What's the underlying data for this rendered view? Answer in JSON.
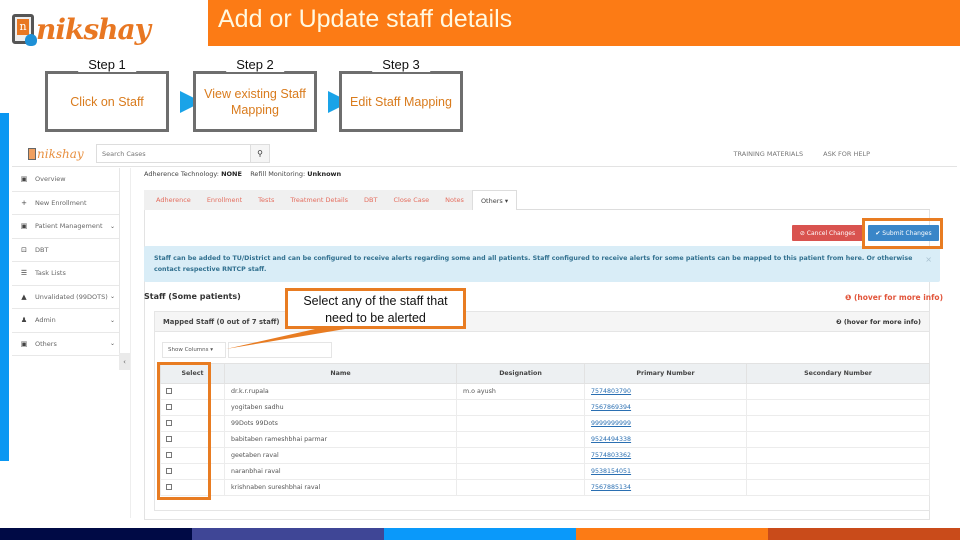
{
  "slide": {
    "logo_text": "nikshay",
    "title": "Add or Update staff details",
    "steps": [
      {
        "label": "Step 1",
        "text": "Click on Staff"
      },
      {
        "label": "Step 2",
        "text": "View existing Staff Mapping"
      },
      {
        "label": "Step 3",
        "text": "Edit Staff Mapping"
      }
    ],
    "callout": "Select any of the staff that need to be alerted",
    "colors": {
      "accent_orange": "#fc7b15",
      "step_text": "#d97b1d",
      "arrow_blue": "#1aa3e8",
      "footer": [
        "#000a45",
        "#3f4696",
        "#0a99fa",
        "#fc7b15",
        "#c94b1a"
      ]
    }
  },
  "app": {
    "logo_text": "nikshay",
    "search": {
      "placeholder": "Search Cases",
      "value": ""
    },
    "top_links": [
      "TRAINING MATERIALS",
      "ASK FOR HELP"
    ],
    "sidebar": [
      {
        "icon": "briefcase-icon",
        "glyph": "▣",
        "label": "Overview",
        "chevron": false
      },
      {
        "icon": "plus-icon",
        "glyph": "+",
        "label": "New Enrollment",
        "chevron": false
      },
      {
        "icon": "folder-icon",
        "glyph": "▣",
        "label": "Patient Management",
        "chevron": true
      },
      {
        "icon": "money-icon",
        "glyph": "⊡",
        "label": "DBT",
        "chevron": false
      },
      {
        "icon": "list-icon",
        "glyph": "☰",
        "label": "Task Lists",
        "chevron": false
      },
      {
        "icon": "warning-icon",
        "glyph": "▲",
        "label": "Unvalidated (99DOTS)",
        "chevron": true
      },
      {
        "icon": "user-icon",
        "glyph": "♟",
        "label": "Admin",
        "chevron": true
      },
      {
        "icon": "others-icon",
        "glyph": "▣",
        "label": "Others",
        "chevron": true
      }
    ],
    "adherence": {
      "tech_label": "Adherence Technology:",
      "tech_value": "NONE",
      "refill_label": "Refill Monitoring:",
      "refill_value": "Unknown"
    },
    "tabs": [
      "Adherence",
      "Enrollment",
      "Tests",
      "Treatment Details",
      "DBT",
      "Close Case",
      "Notes",
      "Others ▾"
    ],
    "active_tab": "Others ▾",
    "buttons": {
      "cancel": "⊘ Cancel Changes",
      "submit": "✔ Submit Changes"
    },
    "alert": "Staff can be added to TU/District and can be configured to receive alerts regarding some and all patients. Staff configured to receive alerts for some patients can be mapped to this patient from here. Or otherwise contact respective RNTCP staff.",
    "alert_close": "×",
    "section_title": "Staff (Some patients)",
    "section_hover": "❶ (hover for more info)",
    "mapped": {
      "title": "Mapped Staff (0 out of 7 staff)",
      "hover": "❷ (hover for more info)",
      "show_columns": "Show Columns ▾",
      "columns": [
        "Select",
        "Name",
        "Designation",
        "Primary Number",
        "Secondary Number"
      ],
      "rows": [
        {
          "name": "dr.k.r.rupala",
          "designation": "m.o ayush",
          "primary": "7574803790",
          "secondary": ""
        },
        {
          "name": "yogitaben sadhu",
          "designation": "",
          "primary": "7567869394",
          "secondary": ""
        },
        {
          "name": "99Dots 99Dots",
          "designation": "",
          "primary": "9999999999",
          "secondary": ""
        },
        {
          "name": "babitaben rameshbhai parmar",
          "designation": "",
          "primary": "9524494338",
          "secondary": ""
        },
        {
          "name": "geetaben raval",
          "designation": "",
          "primary": "7574803362",
          "secondary": ""
        },
        {
          "name": "naranbhai raval",
          "designation": "",
          "primary": "9538154051",
          "secondary": ""
        },
        {
          "name": "krishnaben sureshbhai raval",
          "designation": "",
          "primary": "7567885134",
          "secondary": ""
        }
      ]
    },
    "collapse_glyph": "‹"
  }
}
